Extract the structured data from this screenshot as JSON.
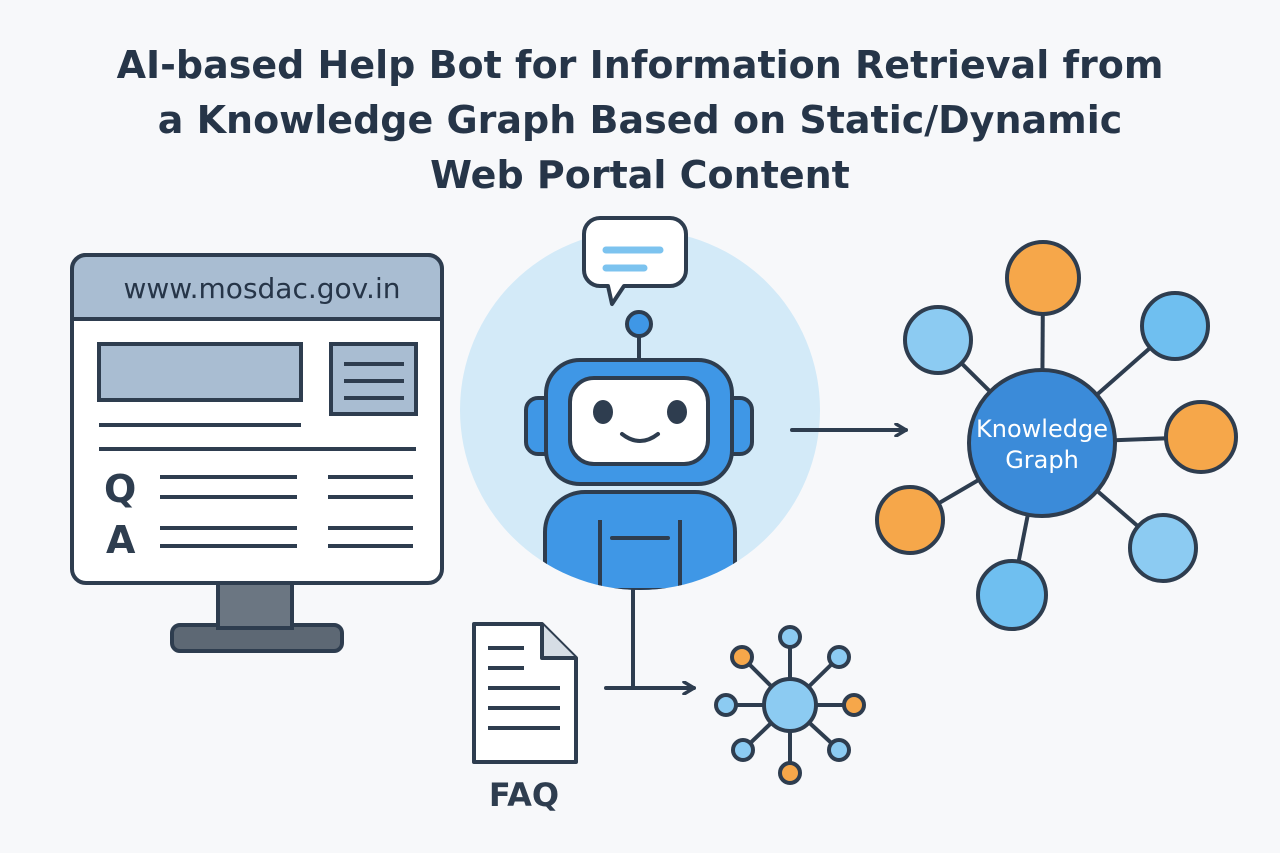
{
  "title": {
    "line1": "AI-based Help Bot for Information Retrieval from",
    "line2": "a Knowledge Graph Based on Static/Dynamic",
    "line3": "Web Portal Content"
  },
  "portal": {
    "url": "www.mosdac.gov.in",
    "q_label": "Q",
    "a_label": "A"
  },
  "faq": {
    "label": "FAQ"
  },
  "knowledge_graph": {
    "label_line1": "Knowledge",
    "label_line2": "Graph"
  },
  "icons": [
    "monitor-icon",
    "chat-bubble-icon",
    "robot-icon",
    "document-icon",
    "network-graph-icon"
  ],
  "colors": {
    "outline": "#2e3d4f",
    "panel": "#a9bdd2",
    "robot_blue": "#3f97e6",
    "node_light": "#8ccbf2",
    "node_orange": "#f6a74a",
    "hub_blue": "#3b8bd9",
    "halo": "#d3eaf8"
  }
}
